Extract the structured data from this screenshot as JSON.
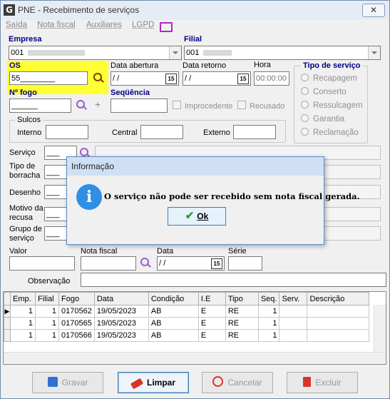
{
  "window": {
    "title": "PNE - Recebimento de serviços",
    "close_glyph": "✕",
    "app_icon_letter": "G"
  },
  "menu": [
    {
      "label": "Saída"
    },
    {
      "label": "Nota fiscal"
    },
    {
      "label": "Auxiliares"
    },
    {
      "label": "LGPD"
    }
  ],
  "form": {
    "empresa_label": "Empresa",
    "empresa_value": "001",
    "filial_label": "Filial",
    "filial_value": "001",
    "os_label": "OS",
    "os_value": "55________",
    "data_abertura_label": "Data abertura",
    "data_abertura_value": " / /",
    "data_retorno_label": "Data retorno",
    "data_retorno_value": " / /",
    "hora_label": "Hora",
    "hora_value": "00:00:00",
    "calendar_label": "15",
    "nfogo_label": "Nº fogo",
    "nfogo_value": "______",
    "sequencia_label": "Seqüência",
    "improcedente_label": "Improcedente",
    "recusado_label": "Recusado",
    "sulcos_label": "Sulcos",
    "interno_label": "Interno",
    "central_label": "Central",
    "externo_label": "Externo",
    "servico_label": "Serviço",
    "servico_value": "___",
    "tipo_borracha_label_1": "Tipo de",
    "tipo_borracha_label_2": "borracha",
    "tipo_borracha_value": "___",
    "desenho_label": "Desenho",
    "desenho_value": "___",
    "motivo_label_1": "Motivo da",
    "motivo_label_2": "recusa",
    "motivo_value": "___",
    "grupo_label_1": "Grupo de",
    "grupo_label_2": "serviço",
    "grupo_value": "___",
    "valor_label": "Valor",
    "nota_fiscal_label": "Nota fiscal",
    "data_label": "Data",
    "data_value": " / /",
    "serie_label": "Série",
    "observacao_label": "Observação"
  },
  "tipo_servico": {
    "title": "Tipo de serviço",
    "options": [
      "Recapagem",
      "Conserto",
      "Ressulcagem",
      "Garantia",
      "Reclamação"
    ]
  },
  "dialog": {
    "title": "Informação",
    "message": "O serviço não pode ser recebido sem nota fiscal gerada.",
    "ok_label": "Ok",
    "info_glyph": "i"
  },
  "grid": {
    "columns": [
      "Emp.",
      "Filial",
      "Fogo",
      "Data",
      "Condição",
      "I.E",
      "Tipo",
      "Seq.",
      "Serv.",
      "Descrição"
    ],
    "rows": [
      [
        "1",
        "1",
        "0170562",
        "19/05/2023",
        "AB",
        "E",
        "RE",
        "1",
        "",
        ""
      ],
      [
        "1",
        "1",
        "0170565",
        "19/05/2023",
        "AB",
        "E",
        "RE",
        "1",
        "",
        ""
      ],
      [
        "1",
        "1",
        "0170566",
        "19/05/2023",
        "AB",
        "E",
        "RE",
        "1",
        "",
        ""
      ]
    ]
  },
  "buttons": {
    "gravar": "Gravar",
    "limpar": "Limpar",
    "cancelar": "Cancelar",
    "excluir": "Excluir"
  },
  "colors": {
    "highlight": "#ffff33",
    "label_blue": "#000080",
    "dialog_header": "#cfe0f5",
    "info_blue": "#2f8ee6"
  }
}
